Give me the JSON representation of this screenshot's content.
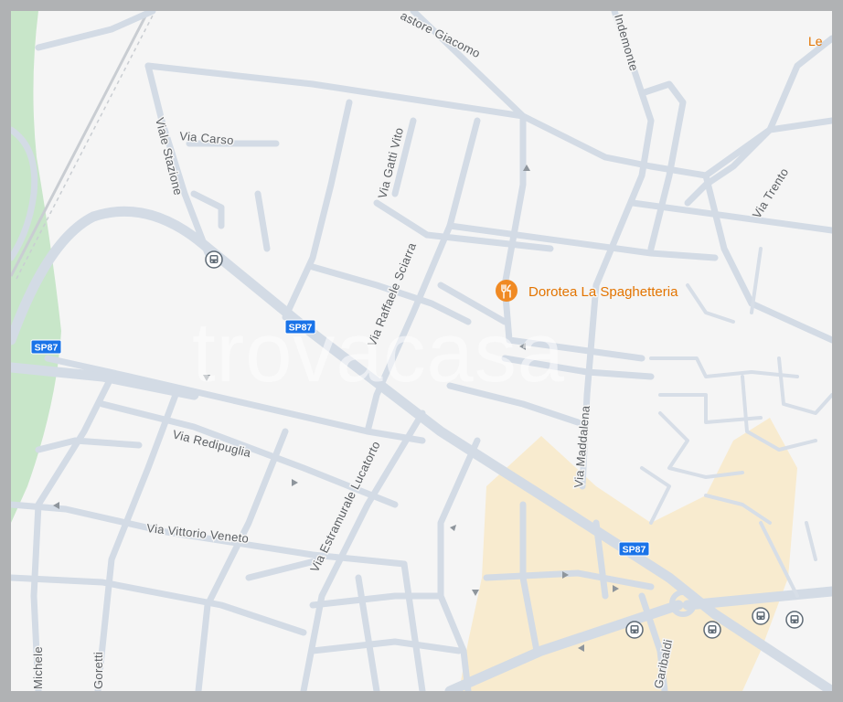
{
  "streets": {
    "castore_giacomo": "astore Giacomo",
    "indemonte": "Indemonte",
    "le": "Le",
    "via_carso": "Via Carso",
    "viale_stazione": "Viale Stazione",
    "via_gatti_vito": "Via Gatti Vito",
    "via_trento": "Via Trento",
    "via_raffaele_sciarra": "Via Raffaele Sciarra",
    "via_maddalena": "Via Maddalena",
    "via_redipuglia": "Via Redipuglia",
    "via_estramurale_lucatorto": "Via Estramurale Lucatorto",
    "via_vittorio_veneto": "Via Vittorio Veneto",
    "michele": "Michele",
    "goretti": "Goretti",
    "garibaldi": "Garibaldi"
  },
  "road_shields": {
    "sp87_left": "SP87",
    "sp87_center": "SP87",
    "sp87_right": "SP87"
  },
  "poi": {
    "name": "Dorotea La Spaghetteria",
    "icon": "restaurant-icon",
    "color": "#f08a24"
  },
  "transit_icons": [
    "bus-stop-icon",
    "bus-stop-icon",
    "bus-stop-icon",
    "bus-stop-icon",
    "bus-stop-icon"
  ],
  "watermark": "trovacasa",
  "colors": {
    "background": "#f5f5f5",
    "road": "#d3dbe5",
    "park": "#c8e6c9",
    "commercial_zone": "#f8ebcf",
    "shield": "#1a73e8",
    "poi": "#e37400"
  }
}
